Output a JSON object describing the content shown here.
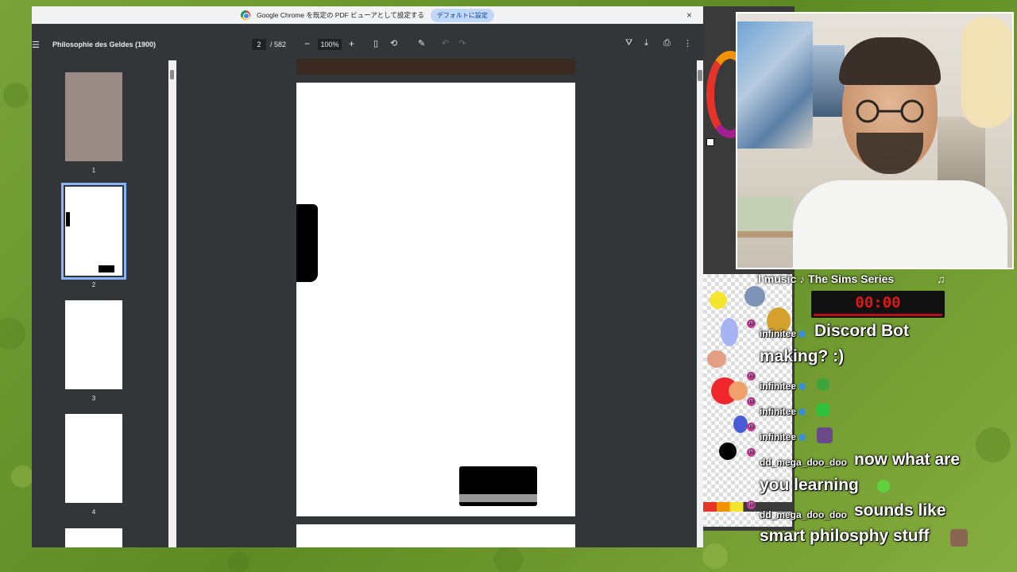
{
  "infobar": {
    "message": "Google Chrome を既定の PDF ビューアとして設定する",
    "default_button": "デフォルトに設定",
    "close": "×"
  },
  "toolbar": {
    "title": "Philosophie des Geldes (1900)",
    "current_page": "2",
    "total_pages": "/ 582",
    "zoom": "100%",
    "zoom_minus": "−",
    "zoom_plus": "+"
  },
  "thumbnails": [
    {
      "number": "1"
    },
    {
      "number": "2"
    },
    {
      "number": "3"
    },
    {
      "number": "4"
    }
  ],
  "overlay": {
    "music": "l music ♪ The Sims Series",
    "music_icon": "♫",
    "timer": "00:00"
  },
  "chat": [
    {
      "user": "infinitee",
      "text_line1": "Discord Bot",
      "text_line2": "making? :)"
    },
    {
      "user": "infinitee",
      "text_line1": ""
    },
    {
      "user": "infinitee",
      "text_line1": ""
    },
    {
      "user": "infinitee",
      "text_line1": ""
    },
    {
      "user": "dd_mega_doo_doo",
      "text_line1": "now what are",
      "text_line2": "you learning"
    },
    {
      "user": "dd_mega_doo_doo",
      "text_line1": "sounds like",
      "text_line2": "smart philosphy stuff"
    }
  ],
  "colors": {
    "accent": "#8ab4f8",
    "timer_red": "#e0161b",
    "chat_badge": "#c43d9a"
  }
}
